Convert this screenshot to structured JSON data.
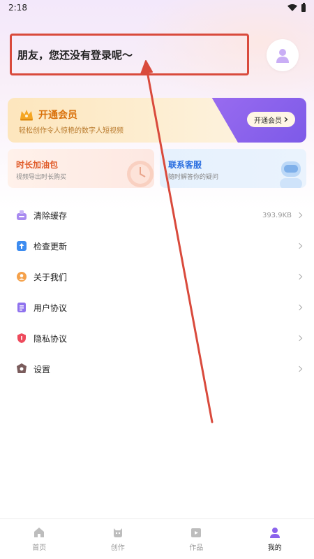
{
  "status_bar": {
    "time": "2:18"
  },
  "header": {
    "greeting": "朋友，您还没有登录呢～"
  },
  "vip": {
    "title": "开通会员",
    "subtitle": "轻松创作令人惊艳的数字人短视频",
    "button_label": "开通会员"
  },
  "cards": {
    "fuel": {
      "title": "时长加油包",
      "subtitle": "视频导出时长购买"
    },
    "service": {
      "title": "联系客服",
      "subtitle": "随时解答你的疑问"
    }
  },
  "menu": {
    "items": [
      {
        "label": "清除缓存",
        "value": "393.9KB",
        "icon": "clear-cache-icon"
      },
      {
        "label": "检查更新",
        "value": "",
        "icon": "update-icon"
      },
      {
        "label": "关于我们",
        "value": "",
        "icon": "about-icon"
      },
      {
        "label": "用户协议",
        "value": "",
        "icon": "agreement-icon"
      },
      {
        "label": "隐私协议",
        "value": "",
        "icon": "privacy-icon"
      },
      {
        "label": "设置",
        "value": "",
        "icon": "settings-icon"
      }
    ]
  },
  "tabs": [
    {
      "label": "首页",
      "icon": "home-icon",
      "active": false
    },
    {
      "label": "创作",
      "icon": "create-icon",
      "active": false
    },
    {
      "label": "作品",
      "icon": "works-icon",
      "active": false
    },
    {
      "label": "我的",
      "icon": "profile-icon",
      "active": true
    }
  ],
  "colors": {
    "annotation": "#d94a3c",
    "accent_purple": "#8b63ec",
    "vip_orange": "#d9700a"
  }
}
